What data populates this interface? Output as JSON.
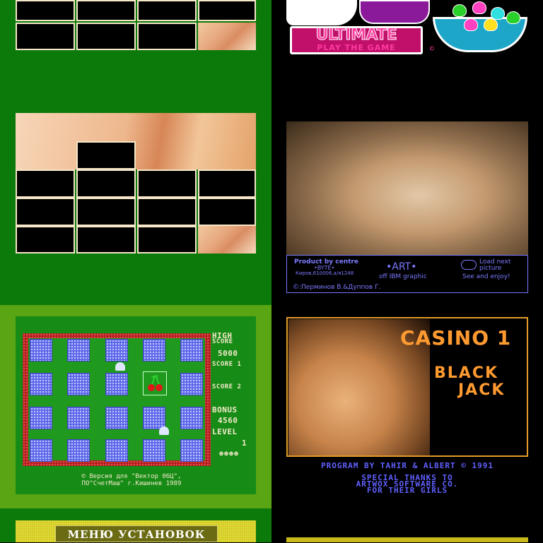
{
  "ultimate": {
    "title": "ULTIMATE",
    "subtitle": "PLAY THE GAME",
    "copyright": "©"
  },
  "memory_game": {
    "hud": {
      "high_label": "HIGH",
      "score_label": "SCORE",
      "high_score": "5000",
      "score1_label": "SCORE 1",
      "score2_label": "SCORE 2",
      "bonus_label": "BONUS",
      "bonus_value": "4560",
      "level_label": "LEVEL",
      "level_value": "1"
    },
    "credit_line1": "©  Версия для \"Вектор 06Ц\",",
    "credit_line2": "ПО\"СчетМаш\" г.Кишинев  1989"
  },
  "menu": {
    "title": "МЕНЮ УСТАНОВОК"
  },
  "art_info": {
    "product_line1": "Product by centre",
    "product_line2": "•BYTE•",
    "product_line3": "Киров,610006,а/я1248",
    "art_title": "•ART•",
    "art_sub": "off IBM graphic",
    "load_line1": "Load next",
    "load_line2": "picture",
    "load_line3": "See and enjoy!",
    "authors": "©:Перминов В.&Дуппов Г."
  },
  "casino": {
    "title": "CASINO 1",
    "line1": "BLACK",
    "line2": "JACK",
    "program_by": "PROGRAM BY TAHIR & ALBERT © 1991",
    "thanks1": "SPECIAL THANKS TO",
    "thanks2": "ARTWOX SOFTWARE CO.",
    "thanks3": "FOR THEIR GIRLS"
  },
  "colors": {
    "left_green": "#0b7a0b",
    "light_green": "#5aa513",
    "casino_orange": "#ff9a30",
    "info_blue": "#7a7aff"
  }
}
